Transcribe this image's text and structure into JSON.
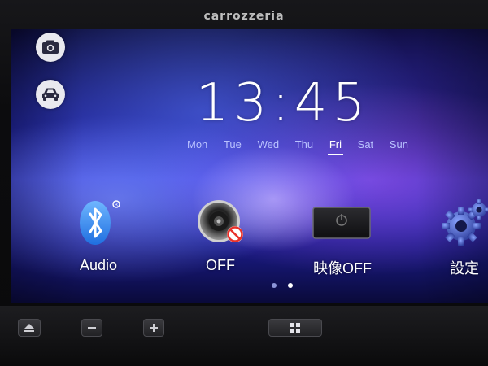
{
  "device": {
    "brand": "carrozzeria"
  },
  "clock": {
    "time": "13:45"
  },
  "weekdays": [
    {
      "label": "Mon",
      "active": false
    },
    {
      "label": "Tue",
      "active": false
    },
    {
      "label": "Wed",
      "active": false
    },
    {
      "label": "Thu",
      "active": false
    },
    {
      "label": "Fri",
      "active": true
    },
    {
      "label": "Sat",
      "active": false
    },
    {
      "label": "Sun",
      "active": false
    }
  ],
  "sidebar": {
    "camera_icon": "camera-icon",
    "car_icon": "car-icon"
  },
  "apps": [
    {
      "label": "Audio",
      "icon": "bluetooth-icon"
    },
    {
      "label": "OFF",
      "icon": "speaker-off-icon"
    },
    {
      "label": "映像OFF",
      "icon": "video-power-icon"
    },
    {
      "label": "設定",
      "icon": "gear-icon"
    }
  ],
  "pager": {
    "pages": 2,
    "current": 2
  },
  "hardware_buttons": {
    "eject_icon": "eject-icon",
    "minus_icon": "minus-icon",
    "plus_icon": "plus-icon",
    "menu_icon": "grid-icon"
  },
  "colors": {
    "bluetooth": "#2f8bff",
    "off_badge": "#e8322b",
    "gear": "#4a64c8"
  }
}
